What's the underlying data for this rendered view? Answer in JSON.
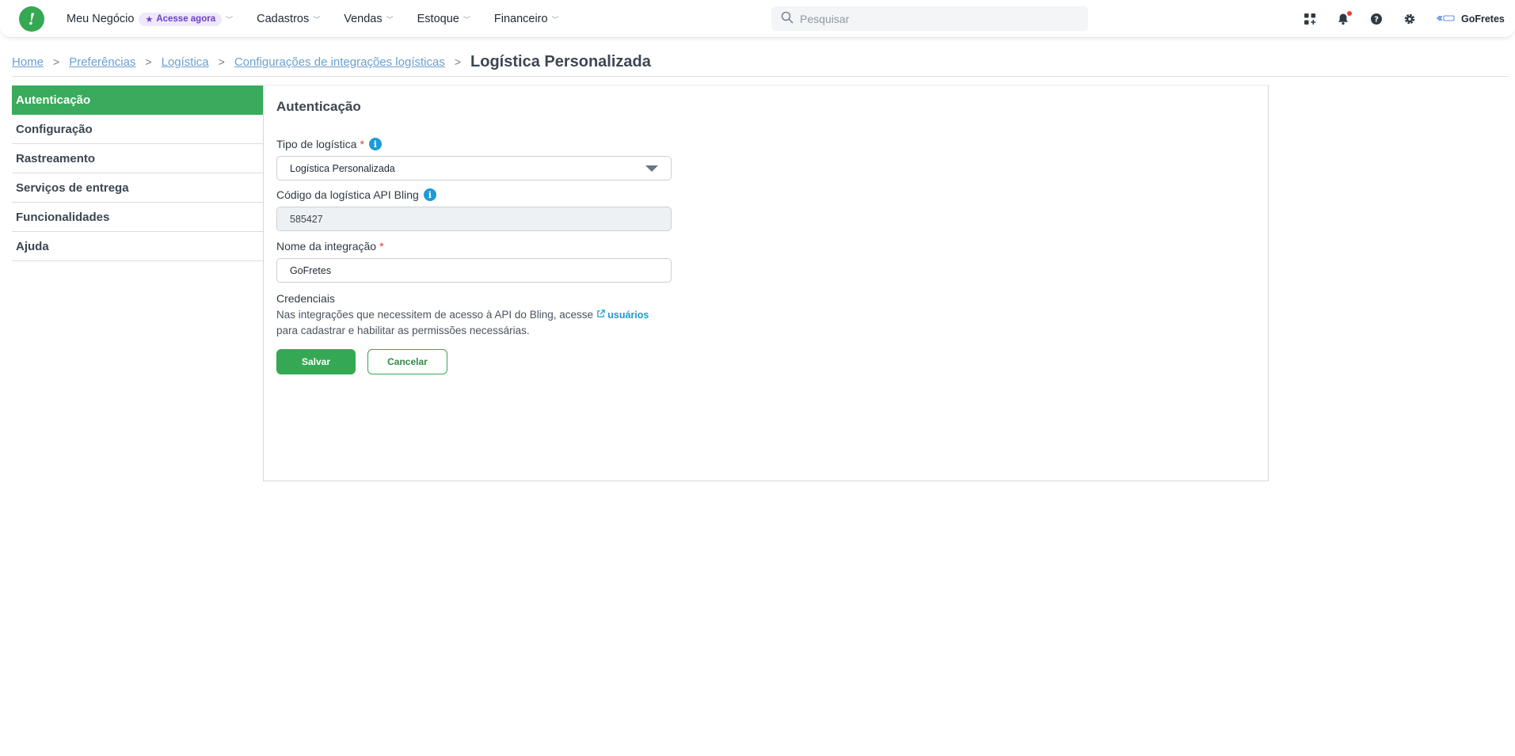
{
  "topbar": {
    "nav": [
      {
        "label": "Meu Negócio",
        "promo": "Acesse agora"
      },
      {
        "label": "Cadastros"
      },
      {
        "label": "Vendas"
      },
      {
        "label": "Estoque"
      },
      {
        "label": "Financeiro"
      }
    ],
    "search_placeholder": "Pesquisar",
    "company_name": "GoFretes",
    "company_logo_text": "GoFretes"
  },
  "breadcrumb": {
    "items": [
      "Home",
      "Preferências",
      "Logística",
      "Configurações de integrações logísticas"
    ],
    "current": "Logística Personalizada"
  },
  "sidebar": {
    "items": [
      {
        "label": "Autenticação",
        "active": true
      },
      {
        "label": "Configuração"
      },
      {
        "label": "Rastreamento"
      },
      {
        "label": "Serviços de entrega"
      },
      {
        "label": "Funcionalidades"
      },
      {
        "label": "Ajuda"
      }
    ]
  },
  "form": {
    "title": "Autenticação",
    "tipo_label": "Tipo de logística",
    "tipo_value": "Logística Personalizada",
    "codigo_label": "Código da logística API Bling",
    "codigo_value": "585427",
    "nome_label": "Nome da integração",
    "nome_value": "GoFretes",
    "credenciais_title": "Credenciais",
    "credenciais_text_1": "Nas integrações que necessitem de acesso à API do Bling, acesse",
    "credenciais_link": "usuários",
    "credenciais_text_2": "para cadastrar e habilitar as permissões necessárias.",
    "save_label": "Salvar",
    "cancel_label": "Cancelar"
  },
  "colors": {
    "brand_green": "#35a853",
    "link_blue": "#1e9bd7",
    "promo_purple": "#6b3fc9"
  }
}
